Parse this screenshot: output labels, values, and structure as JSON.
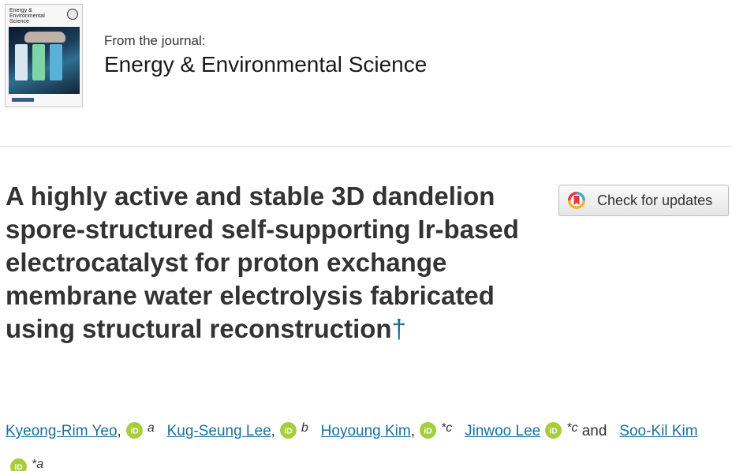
{
  "journal": {
    "cover_title": "Energy & Environmental Science",
    "from_label": "From the journal:",
    "name": "Energy & Environmental Science"
  },
  "article": {
    "title": "A highly active and stable 3D dandelion spore-structured self-supporting Ir-based electrocatalyst for proton exchange membrane water electrolysis fabricated using structural reconstruction",
    "dagger": "†"
  },
  "check_for_updates": {
    "label": "Check for updates",
    "icon": "crossmark-icon"
  },
  "authors": [
    {
      "name": "Kyeong-Rim Yeo",
      "affiliation": "a",
      "separator": ","
    },
    {
      "name": "Kug-Seung Lee",
      "affiliation": "b",
      "separator": ","
    },
    {
      "name": "Hoyoung Kim",
      "affiliation": "*c",
      "separator": ","
    },
    {
      "name": "Jinwoo Lee",
      "affiliation": "*c",
      "separator": "and"
    },
    {
      "name": "Soo-Kil Kim",
      "affiliation": "*a",
      "separator": ""
    }
  ],
  "colors": {
    "link": "#1a6f9c",
    "orcid": "#a6ce39",
    "text": "#333333"
  }
}
